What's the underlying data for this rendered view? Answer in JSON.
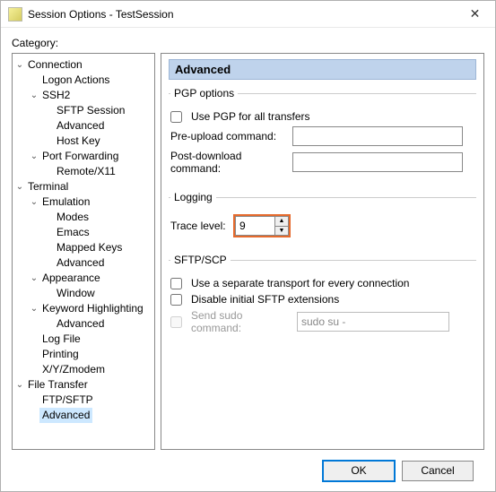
{
  "window": {
    "title": "Session Options - TestSession"
  },
  "category_label": "Category:",
  "tree": {
    "connection": "Connection",
    "logon_actions": "Logon Actions",
    "ssh2": "SSH2",
    "sftp_session": "SFTP Session",
    "advanced_ssh2": "Advanced",
    "host_key": "Host Key",
    "port_forwarding": "Port Forwarding",
    "remote_x11": "Remote/X11",
    "terminal": "Terminal",
    "emulation": "Emulation",
    "modes": "Modes",
    "emacs": "Emacs",
    "mapped_keys": "Mapped Keys",
    "advanced_emul": "Advanced",
    "appearance": "Appearance",
    "window": "Window",
    "keyword_hl": "Keyword Highlighting",
    "advanced_kw": "Advanced",
    "log_file": "Log File",
    "printing": "Printing",
    "xyzmodem": "X/Y/Zmodem",
    "file_transfer": "File Transfer",
    "ftp_sftp": "FTP/SFTP",
    "advanced_ft": "Advanced"
  },
  "panel": {
    "header": "Advanced",
    "pgp": {
      "legend": "PGP options",
      "use_pgp": "Use PGP for all transfers",
      "pre_upload_label": "Pre-upload command:",
      "pre_upload_value": "",
      "post_download_label": "Post-download command:",
      "post_download_value": ""
    },
    "logging": {
      "legend": "Logging",
      "trace_label": "Trace level:",
      "trace_value": "9"
    },
    "sftp": {
      "legend": "SFTP/SCP",
      "separate_transport": "Use a separate transport for every connection",
      "disable_ext": "Disable initial SFTP extensions",
      "send_sudo_label": "Send sudo command:",
      "send_sudo_value": "sudo su -"
    }
  },
  "buttons": {
    "ok": "OK",
    "cancel": "Cancel"
  }
}
